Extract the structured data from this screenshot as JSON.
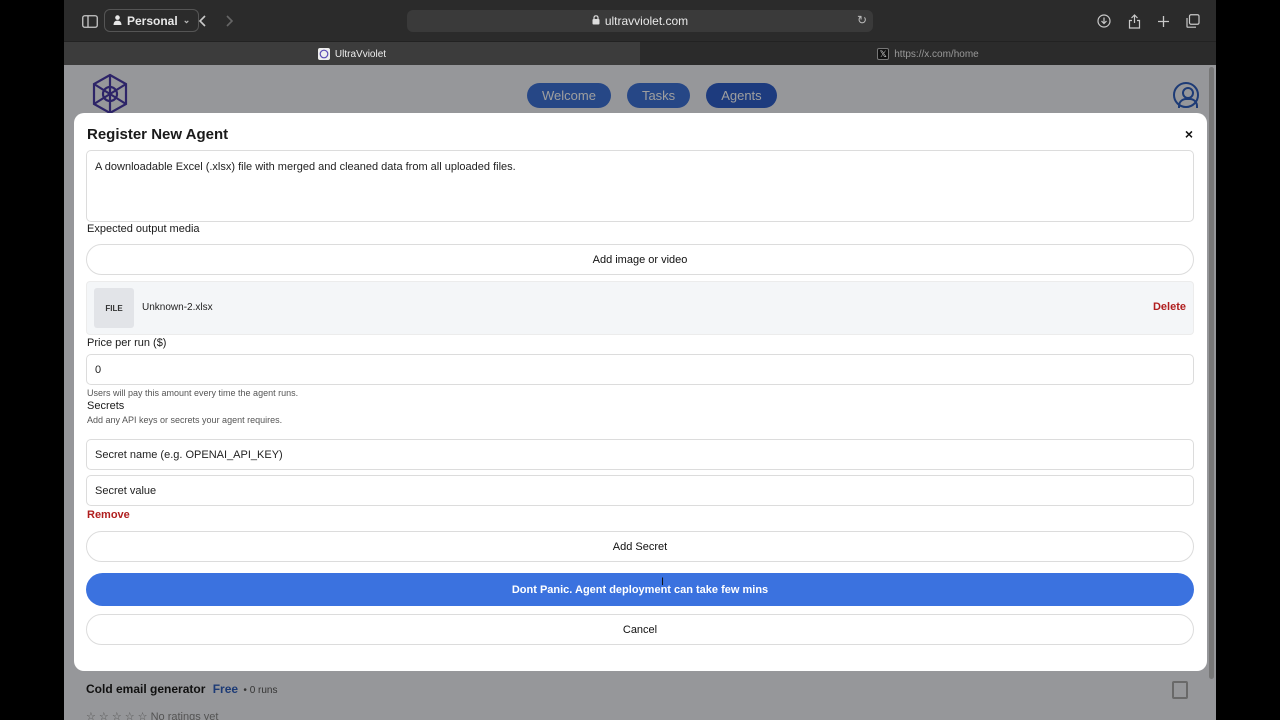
{
  "browser": {
    "profile_label": "Personal",
    "url": "ultravviolet.com",
    "tabs": [
      {
        "title": "UltraVviolet"
      },
      {
        "title": "https://x.com/home"
      }
    ]
  },
  "nav": {
    "items": [
      "Welcome",
      "Tasks",
      "Agents"
    ]
  },
  "modal": {
    "title": "Register New Agent",
    "close_label": "×",
    "description_value": "A downloadable Excel (.xlsx) file with merged and cleaned data from all uploaded files.",
    "expected_output_label": "Expected output media",
    "add_media_label": "Add image or video",
    "file": {
      "thumb_label": "FILE",
      "name": "Unknown-2.xlsx",
      "delete_label": "Delete"
    },
    "price_label": "Price per run ($)",
    "price_value": "0",
    "price_hint": "Users will pay this amount every time the agent runs.",
    "secrets_label": "Secrets",
    "secrets_hint": "Add any API keys or secrets your agent requires.",
    "secret_name_placeholder": "Secret name (e.g. OPENAI_API_KEY)",
    "secret_value_placeholder": "Secret value",
    "remove_label": "Remove",
    "add_secret_label": "Add Secret",
    "deploy_label": "Dont Panic. Agent deployment can take few mins",
    "cancel_label": "Cancel"
  },
  "background_card": {
    "title": "Cold email generator",
    "price": "Free",
    "runs": "• 0 runs",
    "rating_text": "No ratings yet",
    "stars": "☆ ☆ ☆ ☆ ☆"
  },
  "colors": {
    "accent": "#3b72df",
    "danger": "#b01e1e"
  }
}
